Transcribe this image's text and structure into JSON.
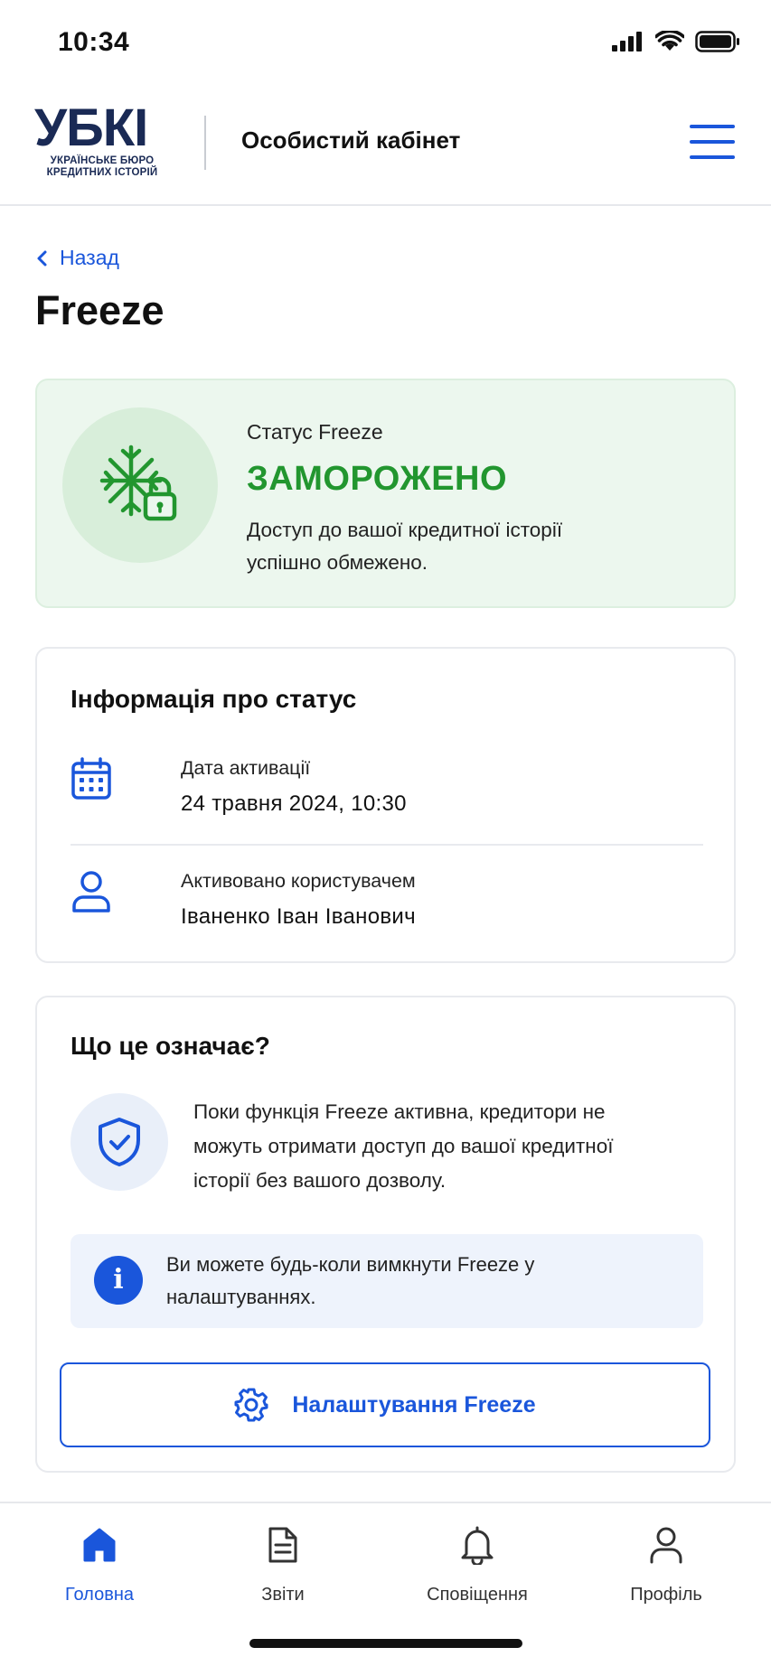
{
  "status_bar": {
    "time": "10:34"
  },
  "header": {
    "logo_main": "УБКІ",
    "logo_sub_line1": "УКРАЇНСЬКЕ БЮРО",
    "logo_sub_line2": "КРЕДИТНИХ ІСТОРІЙ",
    "title": "Особистий кабінет"
  },
  "nav": {
    "back_label": "Назад"
  },
  "page_title": "Freeze",
  "status_card": {
    "label": "Статус Freeze",
    "value": "ЗАМОРОЖЕНО",
    "description": "Доступ до вашої кредитної історії успішно обмежено."
  },
  "info_card": {
    "title": "Інформація про статус",
    "rows": [
      {
        "label": "Дата активації",
        "value": "24 травня 2024, 10:30",
        "icon": "calendar-icon"
      },
      {
        "label": "Активовано користувачем",
        "value": "Іваненко Іван Іванович",
        "icon": "user-icon"
      }
    ]
  },
  "what_card": {
    "title": "Що це означає?",
    "text": "Поки функція Freeze активна, кредитори не можуть отримати доступ до вашої кредитної історії без вашого дозволу.",
    "notice": "Ви можете будь-коли вимкнути Freeze у налаштуваннях.",
    "button_label": "Налаштування Freeze"
  },
  "tabbar": {
    "tabs": [
      {
        "label": "Головна",
        "icon": "home-icon",
        "active": true
      },
      {
        "label": "Звіти",
        "icon": "document-icon",
        "active": false
      },
      {
        "label": "Сповіщення",
        "icon": "bell-icon",
        "active": false
      },
      {
        "label": "Профіль",
        "icon": "profile-icon",
        "active": false
      }
    ]
  },
  "colors": {
    "accent": "#1a56db",
    "success": "#22962f",
    "status_bg": "#ecf7ee",
    "brand": "#1a2a55"
  }
}
